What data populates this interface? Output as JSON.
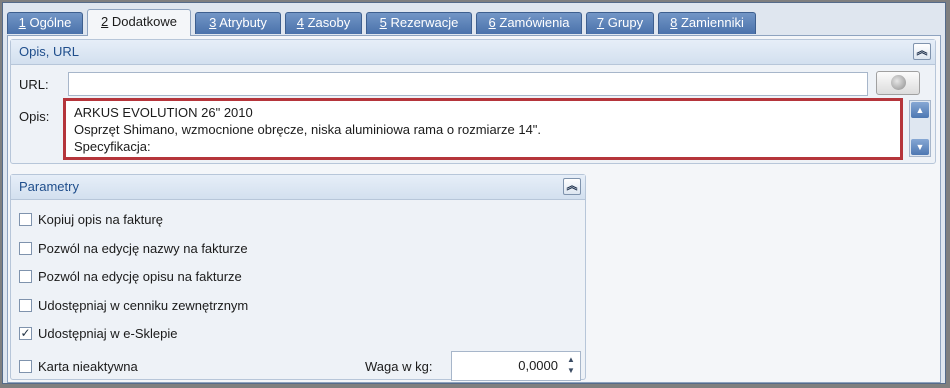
{
  "tabs": [
    {
      "num": "1",
      "label": " Ogólne"
    },
    {
      "num": "2",
      "label": " Dodatkowe"
    },
    {
      "num": "3",
      "label": " Atrybuty"
    },
    {
      "num": "4",
      "label": " Zasoby"
    },
    {
      "num": "5",
      "label": " Rezerwacje"
    },
    {
      "num": "6",
      "label": " Zamówienia"
    },
    {
      "num": "7",
      "label": " Grupy"
    },
    {
      "num": "8",
      "label": " Zamienniki"
    }
  ],
  "active_tab": "2 Dodatkowe",
  "opis_group": {
    "title": "Opis, URL",
    "collapse_glyph": "︽",
    "url_label": "URL:",
    "url_value": "",
    "opis_label": "Opis:",
    "opis_lines": [
      "ARKUS EVOLUTION 26\" 2010",
      "Osprzęt Shimano, wzmocnione obręcze, niska aluminiowa rama o rozmiarze 14\".",
      "Specyfikacja:"
    ],
    "scroll_up": "▲",
    "scroll_down": "▼"
  },
  "parametry": {
    "title": "Parametry",
    "collapse_glyph": "︽",
    "checkboxes": [
      {
        "label": "Kopiuj opis na fakturę",
        "checked": false,
        "mark": ""
      },
      {
        "label": "Pozwól na edycję nazwy na fakturze",
        "checked": false,
        "mark": ""
      },
      {
        "label": "Pozwól na edycję opisu na fakturze",
        "checked": false,
        "mark": ""
      },
      {
        "label": "Udostępniaj w cenniku zewnętrznym",
        "checked": false,
        "mark": ""
      },
      {
        "label": "Udostępniaj w e-Sklepie",
        "checked": true,
        "mark": "✓"
      },
      {
        "label": "Karta nieaktywna",
        "checked": false,
        "mark": ""
      }
    ],
    "waga_label": "Waga w kg:",
    "waga_value": "0,0000",
    "spin_up": "▲",
    "spin_down": "▼"
  },
  "colors": {
    "tab_bg": "#5a80b8",
    "highlight_border": "#b5353b",
    "group_title": "#1f4e8c"
  }
}
